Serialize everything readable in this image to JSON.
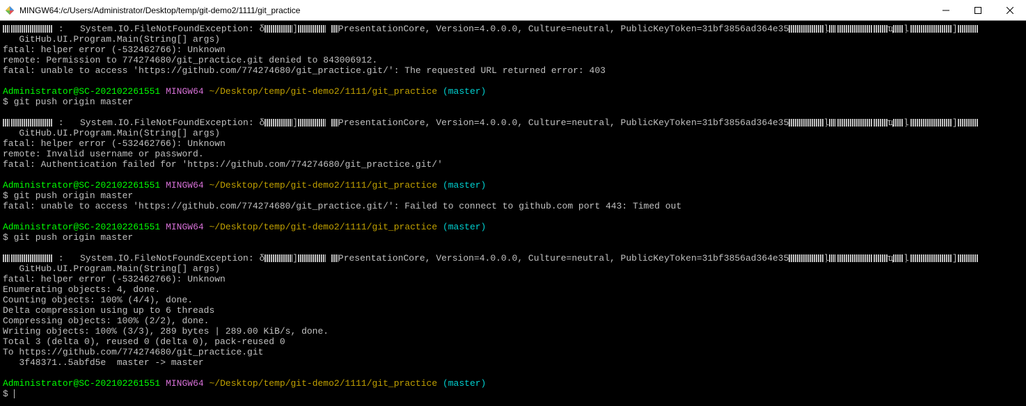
{
  "window": {
    "title": "MINGW64:/c/Users/Administrator/Desktop/temp/git-demo2/1111/git_practice"
  },
  "prompt": {
    "user_host": "Administrator@SC-202102261551",
    "shell": "MINGW64",
    "path": "~/Desktop/temp/git-demo2/1111/git_practice",
    "branch": "(master)",
    "sigil": "$"
  },
  "blocks": [
    {
      "lines": [
        {
          "type": "garbled_exception_line",
          "segments": [
            ": ",
            "  System.IO.FileNotFoundException: δ",
            "PresentationCore, Version=4.0.0.0, Culture=neutral, PublicKeyToken=31bf3856ad364e35",
            "ļ"
          ]
        },
        {
          "type": "text",
          "text": "   GitHub.UI.Program.Main(String[] args)"
        },
        {
          "type": "text",
          "text": "fatal: helper error (-532462766): Unknown"
        },
        {
          "type": "text",
          "text": "remote: Permission to 774274680/git_practice.git denied to 843006912."
        },
        {
          "type": "text",
          "text": "fatal: unable to access 'https://github.com/774274680/git_practice.git/': The requested URL returned error: 403"
        }
      ]
    },
    {
      "lines": [
        {
          "type": "prompt"
        },
        {
          "type": "cmd",
          "text": "git push origin master"
        },
        {
          "type": "blank"
        },
        {
          "type": "garbled_exception_line",
          "segments": [
            ": ",
            "  System.IO.FileNotFoundException: δ",
            "PresentationCore, Version=4.0.0.0, Culture=neutral, PublicKeyToken=31bf3856ad364e35",
            "ļ"
          ]
        },
        {
          "type": "text",
          "text": "   GitHub.UI.Program.Main(String[] args)"
        },
        {
          "type": "text",
          "text": "fatal: helper error (-532462766): Unknown"
        },
        {
          "type": "text",
          "text": "remote: Invalid username or password."
        },
        {
          "type": "text",
          "text": "fatal: Authentication failed for 'https://github.com/774274680/git_practice.git/'"
        }
      ]
    },
    {
      "lines": [
        {
          "type": "prompt"
        },
        {
          "type": "cmd",
          "text": "git push origin master"
        },
        {
          "type": "text",
          "text": "fatal: unable to access 'https://github.com/774274680/git_practice.git/': Failed to connect to github.com port 443: Timed out"
        }
      ]
    },
    {
      "lines": [
        {
          "type": "prompt"
        },
        {
          "type": "cmd",
          "text": "git push origin master"
        },
        {
          "type": "blank"
        },
        {
          "type": "garbled_exception_line",
          "segments": [
            ": ",
            "  System.IO.FileNotFoundException: δ",
            "PresentationCore, Version=4.0.0.0, Culture=neutral, PublicKeyToken=31bf3856ad364e35",
            "ļ"
          ]
        },
        {
          "type": "text",
          "text": "   GitHub.UI.Program.Main(String[] args)"
        },
        {
          "type": "text",
          "text": "fatal: helper error (-532462766): Unknown"
        },
        {
          "type": "text",
          "text": "Enumerating objects: 4, done."
        },
        {
          "type": "text",
          "text": "Counting objects: 100% (4/4), done."
        },
        {
          "type": "text",
          "text": "Delta compression using up to 6 threads"
        },
        {
          "type": "text",
          "text": "Compressing objects: 100% (2/2), done."
        },
        {
          "type": "text",
          "text": "Writing objects: 100% (3/3), 289 bytes | 289.00 KiB/s, done."
        },
        {
          "type": "text",
          "text": "Total 3 (delta 0), reused 0 (delta 0), pack-reused 0"
        },
        {
          "type": "text",
          "text": "To https://github.com/774274680/git_practice.git"
        },
        {
          "type": "text",
          "text": "   3f48371..5abfd5e  master -> master"
        }
      ]
    },
    {
      "lines": [
        {
          "type": "prompt"
        },
        {
          "type": "cursor"
        }
      ]
    }
  ]
}
